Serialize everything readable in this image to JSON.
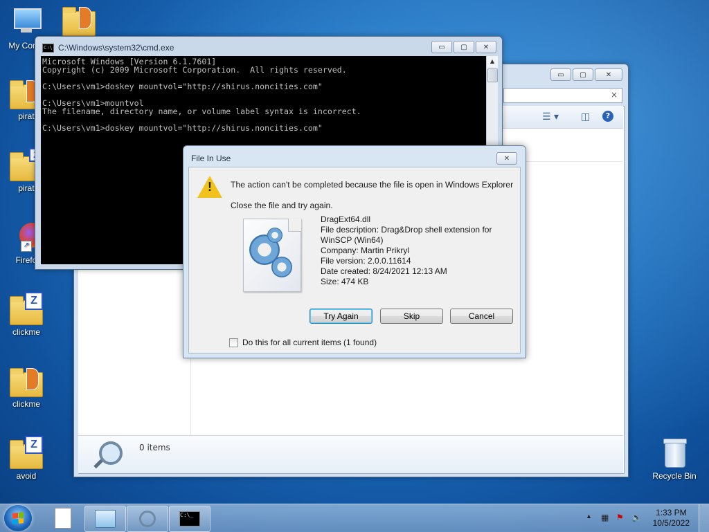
{
  "desktop": {
    "icons": [
      {
        "label": "My Comp"
      },
      {
        "label": ""
      },
      {
        "label": "pirat"
      },
      {
        "label": "pirat"
      },
      {
        "label": "Firefo"
      },
      {
        "label": "clickme"
      },
      {
        "label": "clickme"
      },
      {
        "label": "avoid"
      },
      {
        "label": "Recycle Bin"
      }
    ]
  },
  "explorer": {
    "caption_buttons": {
      "min": "▭",
      "max": "▢",
      "close": "✕"
    },
    "address_clear": "×",
    "status": {
      "items": "0 items"
    }
  },
  "cmd": {
    "title": "C:\\Windows\\system32\\cmd.exe",
    "caption_buttons": {
      "min": "▭",
      "max": "▢",
      "close": "✕"
    },
    "console_text": "Microsoft Windows [Version 6.1.7601]\nCopyright (c) 2009 Microsoft Corporation.  All rights reserved.\n\nC:\\Users\\vm1>doskey mountvol=\"http://shirus.noncities.com\"\n\nC:\\Users\\vm1>mountvol\nThe filename, directory name, or volume label syntax is incorrect.\n\nC:\\Users\\vm1>doskey mountvol=\"http://shirus.noncities.com\""
  },
  "dialog": {
    "title": "File In Use",
    "close": "✕",
    "message": "The action can't be completed because the file is open in Windows Explorer",
    "hint": "Close the file and try again.",
    "file": {
      "name": "DragExt64.dll",
      "description_1": "File description: Drag&Drop shell extension for",
      "description_2": "WinSCP (Win64)",
      "company": "Company: Martin Prikryl",
      "version": "File version: 2.0.0.11614",
      "created": "Date created: 8/24/2021 12:13 AM",
      "size": "Size: 474 KB"
    },
    "buttons": {
      "try_again": "Try Again",
      "skip": "Skip",
      "cancel": "Cancel"
    },
    "checkbox_label": "Do this for all current items (1 found)",
    "checkbox_checked": false
  },
  "taskbar": {
    "clock_time": "1:33 PM",
    "clock_date": "10/5/2022",
    "tray_overflow": "▲"
  }
}
